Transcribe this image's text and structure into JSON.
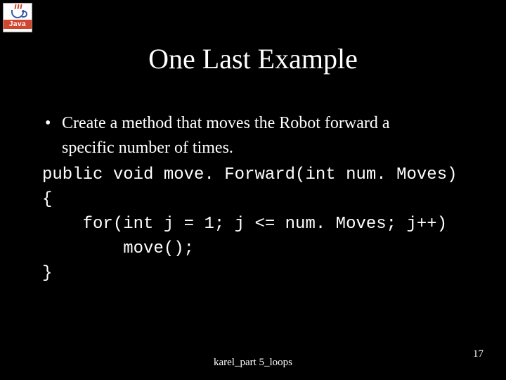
{
  "logo": {
    "text": "Java"
  },
  "title": "One Last Example",
  "bullet": {
    "line1": "Create a method that moves the Robot forward a",
    "line2": "specific number of times."
  },
  "code": {
    "l1": "public void move. Forward(int num. Moves)",
    "l2": "{",
    "l3": "    for(int j = 1; j <= num. Moves; j++)",
    "l4": "        move();",
    "l5": "}"
  },
  "footer": {
    "center": "karel_part 5_loops",
    "right": "17"
  }
}
